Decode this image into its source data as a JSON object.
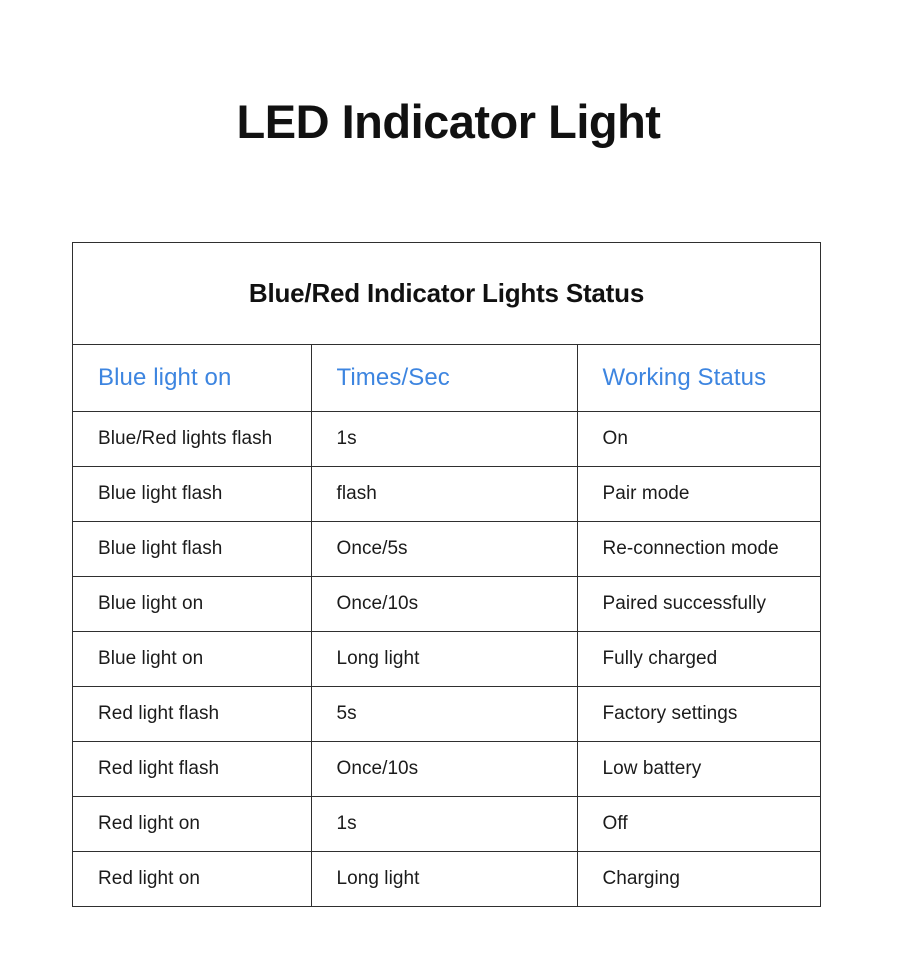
{
  "page": {
    "title": "LED Indicator Light",
    "background_color": "#ffffff"
  },
  "table": {
    "caption": "Blue/Red Indicator Lights Status",
    "header_color": "#3d85e0",
    "border_color": "#2f2f2f",
    "body_text_color": "#1b1b1b",
    "columns": [
      {
        "label": "Blue light on"
      },
      {
        "label": "Times/Sec"
      },
      {
        "label": "Working Status"
      }
    ],
    "rows": [
      {
        "indicator": "Blue/Red lights flash",
        "times_per_sec": "1s",
        "working_status": "On"
      },
      {
        "indicator": "Blue light flash",
        "times_per_sec": "flash",
        "working_status": "Pair mode"
      },
      {
        "indicator": "Blue light flash",
        "times_per_sec": "Once/5s",
        "working_status": "Re-connection mode"
      },
      {
        "indicator": "Blue light on",
        "times_per_sec": "Once/10s",
        "working_status": "Paired successfully"
      },
      {
        "indicator": "Blue light on",
        "times_per_sec": "Long light",
        "working_status": "Fully charged"
      },
      {
        "indicator": "Red light flash",
        "times_per_sec": "5s",
        "working_status": "Factory settings"
      },
      {
        "indicator": "Red light flash",
        "times_per_sec": "Once/10s",
        "working_status": "Low battery"
      },
      {
        "indicator": "Red light on",
        "times_per_sec": "1s",
        "working_status": "Off"
      },
      {
        "indicator": "Red light on",
        "times_per_sec": "Long light",
        "working_status": "Charging"
      }
    ]
  }
}
